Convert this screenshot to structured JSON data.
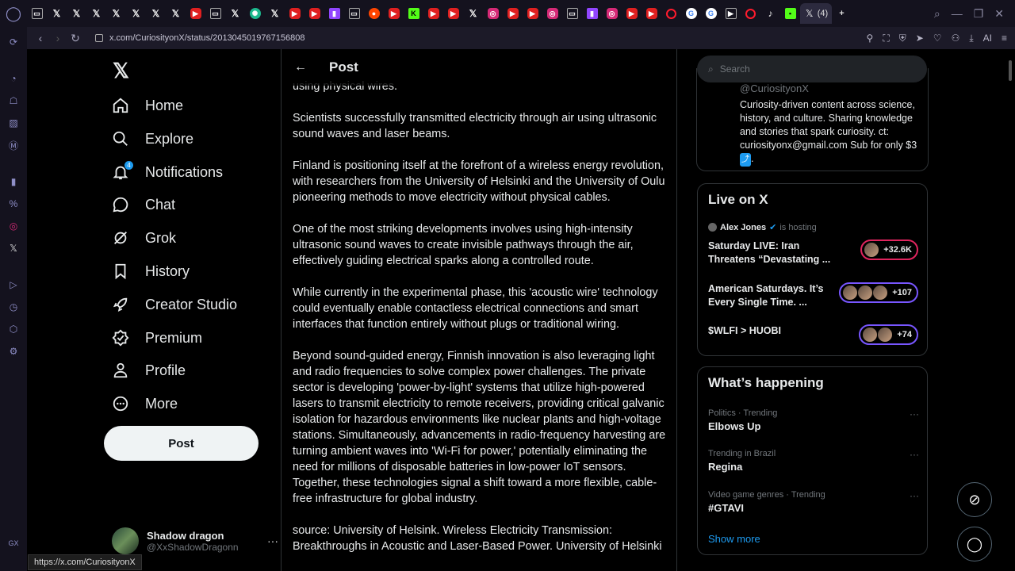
{
  "browser": {
    "tab_count": "(4)",
    "url": "x.com/CuriosityonX/status/2013045019767156808",
    "tabs": [
      "x-tab",
      "x-tab",
      "x-tab",
      "x-tab",
      "x-tab",
      "x-tab",
      "x-tab",
      "youtube-tab",
      "page-tab",
      "x-tab",
      "chatgpt-tab",
      "x-tab",
      "youtube-tab",
      "youtube-tab",
      "twitch-tab",
      "page-tab",
      "reddit-tab",
      "youtube-tab",
      "kick-tab",
      "youtube-tab",
      "youtube-tab",
      "x-tab",
      "instagram-tab",
      "youtube-tab",
      "youtube-tab",
      "instagram-tab",
      "page-tab",
      "youtube-tab",
      "instagram-tab",
      "youtube-tab",
      "youtube-tab",
      "opera-tab",
      "google-tab",
      "google-tab",
      "page-tab",
      "opera-tab",
      "tiktok-tab",
      "greenapp-tab"
    ]
  },
  "x_nav": {
    "items": [
      {
        "label": "Home",
        "icon": "home-icon"
      },
      {
        "label": "Explore",
        "icon": "search-icon"
      },
      {
        "label": "Notifications",
        "icon": "bell-icon",
        "badge": "4"
      },
      {
        "label": "Chat",
        "icon": "chat-icon"
      },
      {
        "label": "Grok",
        "icon": "grok-icon"
      },
      {
        "label": "History",
        "icon": "bookmark-icon"
      },
      {
        "label": "Creator Studio",
        "icon": "rocket-icon"
      },
      {
        "label": "Premium",
        "icon": "verified-icon"
      },
      {
        "label": "Profile",
        "icon": "person-icon"
      },
      {
        "label": "More",
        "icon": "more-circle-icon"
      }
    ],
    "post_button": "Post",
    "account": {
      "name": "Shadow dragon",
      "handle": "@XxShadowDragonn"
    }
  },
  "post": {
    "header_title": "Post",
    "paragraphs": [
      "using physical wires.",
      "Scientists successfully transmitted electricity through air using ultrasonic sound waves and laser beams.",
      "Finland is positioning itself at the forefront of a wireless energy revolution, with researchers from the University of Helsinki and the University of Oulu pioneering methods to move electricity without physical cables.",
      "One of the most striking developments involves using high-intensity ultrasonic sound waves to create invisible pathways through the air, effectively guiding electrical sparks along a controlled route.",
      "While currently in the experimental phase, this 'acoustic wire' technology could eventually enable contactless electrical connections and smart interfaces that function entirely without plugs or traditional wiring.",
      "Beyond sound-guided energy, Finnish innovation is also leveraging light and radio frequencies to solve complex power challenges. The private sector is developing 'power-by-light' systems that utilize high-powered lasers to transmit electricity to remote receivers, providing critical galvanic isolation for hazardous environments like nuclear plants and high-voltage stations. Simultaneously, advancements in radio-frequency harvesting are turning ambient waves into 'Wi-Fi for power,' potentially eliminating the need for millions of disposable batteries in low-power IoT sensors. Together, these technologies signal a shift toward a more flexible, cable-free infrastructure for global industry.",
      "source: University of Helsink. Wireless Electricity Transmission: Breakthroughs in Acoustic and Laser-Based Power. University of Helsinki"
    ]
  },
  "right": {
    "search_placeholder": "Search",
    "profile": {
      "handle": "@CuriosityonX",
      "bio": "Curiosity-driven content across science, history, and culture. Sharing knowledge and stories that spark curiosity. ct: curiosityonx@gmail.com Sub for only $3",
      "bio_emoji": "⤴",
      "bio_end": "."
    },
    "live": {
      "title": "Live on X",
      "host_name": "Alex Jones",
      "host_suffix": "is hosting",
      "spaces": [
        {
          "title": "Saturday LIVE: Iran Threatens “Devastating ...",
          "count": "+32.6K",
          "style": "red"
        },
        {
          "title": "American Saturdays. It’s Every Single Time. ...",
          "count": "+107",
          "style": "purple"
        },
        {
          "title": "$WLFI > HUOBI",
          "count": "+74",
          "style": "purple"
        }
      ]
    },
    "happening": {
      "title": "What’s happening",
      "trends": [
        {
          "category": "Politics · Trending",
          "name": "Elbows Up"
        },
        {
          "category": "Trending in Brazil",
          "name": "Regina"
        },
        {
          "category": "Video game genres · Trending",
          "name": "#GTAVI"
        }
      ],
      "show_more": "Show more"
    }
  },
  "status_tip": "https://x.com/CuriosityonX",
  "ai_label": "AI"
}
